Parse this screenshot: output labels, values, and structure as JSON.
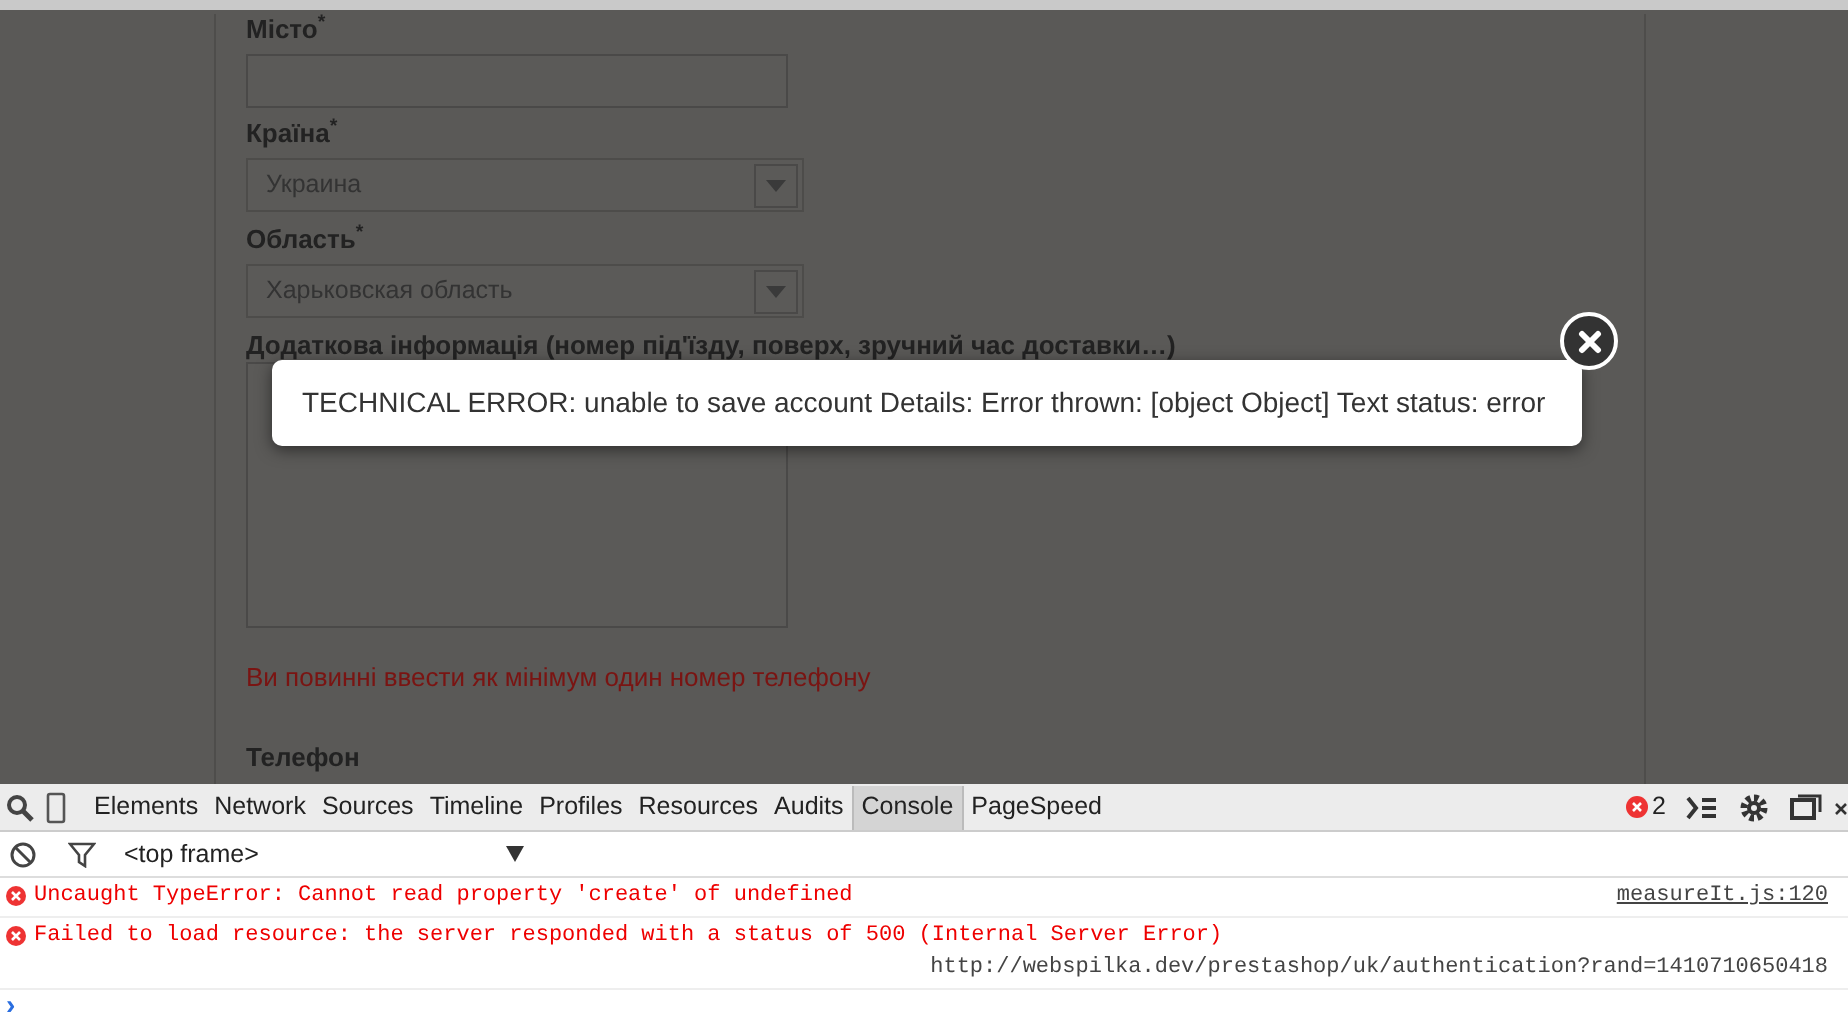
{
  "form": {
    "fields": [
      {
        "kind": "text",
        "label": "Місто",
        "mark": "*"
      },
      {
        "kind": "select",
        "label": "Країна",
        "mark": "*",
        "value": "Украина"
      },
      {
        "kind": "select",
        "label": "Область",
        "mark": "*",
        "value": "Харьковская область"
      },
      {
        "kind": "textarea",
        "label": "Додаткова інформація (номер під'їзду, поверх, зручний час доставки…)"
      }
    ],
    "error": "Ви повинні ввести як мінімум один номер телефону",
    "next_label": "Телефон"
  },
  "modal": {
    "message": "TECHNICAL ERROR: unable to save account Details: Error thrown: [object Object] Text status: error"
  },
  "devtools": {
    "tabs": [
      {
        "label": "Elements",
        "selected": false
      },
      {
        "label": "Network",
        "selected": false
      },
      {
        "label": "Sources",
        "selected": false
      },
      {
        "label": "Timeline",
        "selected": false
      },
      {
        "label": "Profiles",
        "selected": false
      },
      {
        "label": "Resources",
        "selected": false
      },
      {
        "label": "Audits",
        "selected": false
      },
      {
        "label": "Console",
        "selected": true
      },
      {
        "label": "PageSpeed",
        "selected": false
      }
    ],
    "error_count": "2",
    "frame": "<top frame>",
    "messages": [
      {
        "text": "Uncaught TypeError: Cannot read property 'create' of undefined",
        "source": "measureIt.js:120"
      },
      {
        "text": "Failed to load resource: the server responded with a status of 500 (Internal Server Error)",
        "url": "http://webspilka.dev/prestashop/uk/authentication?rand=1410710650418"
      }
    ],
    "prompt": "›"
  }
}
